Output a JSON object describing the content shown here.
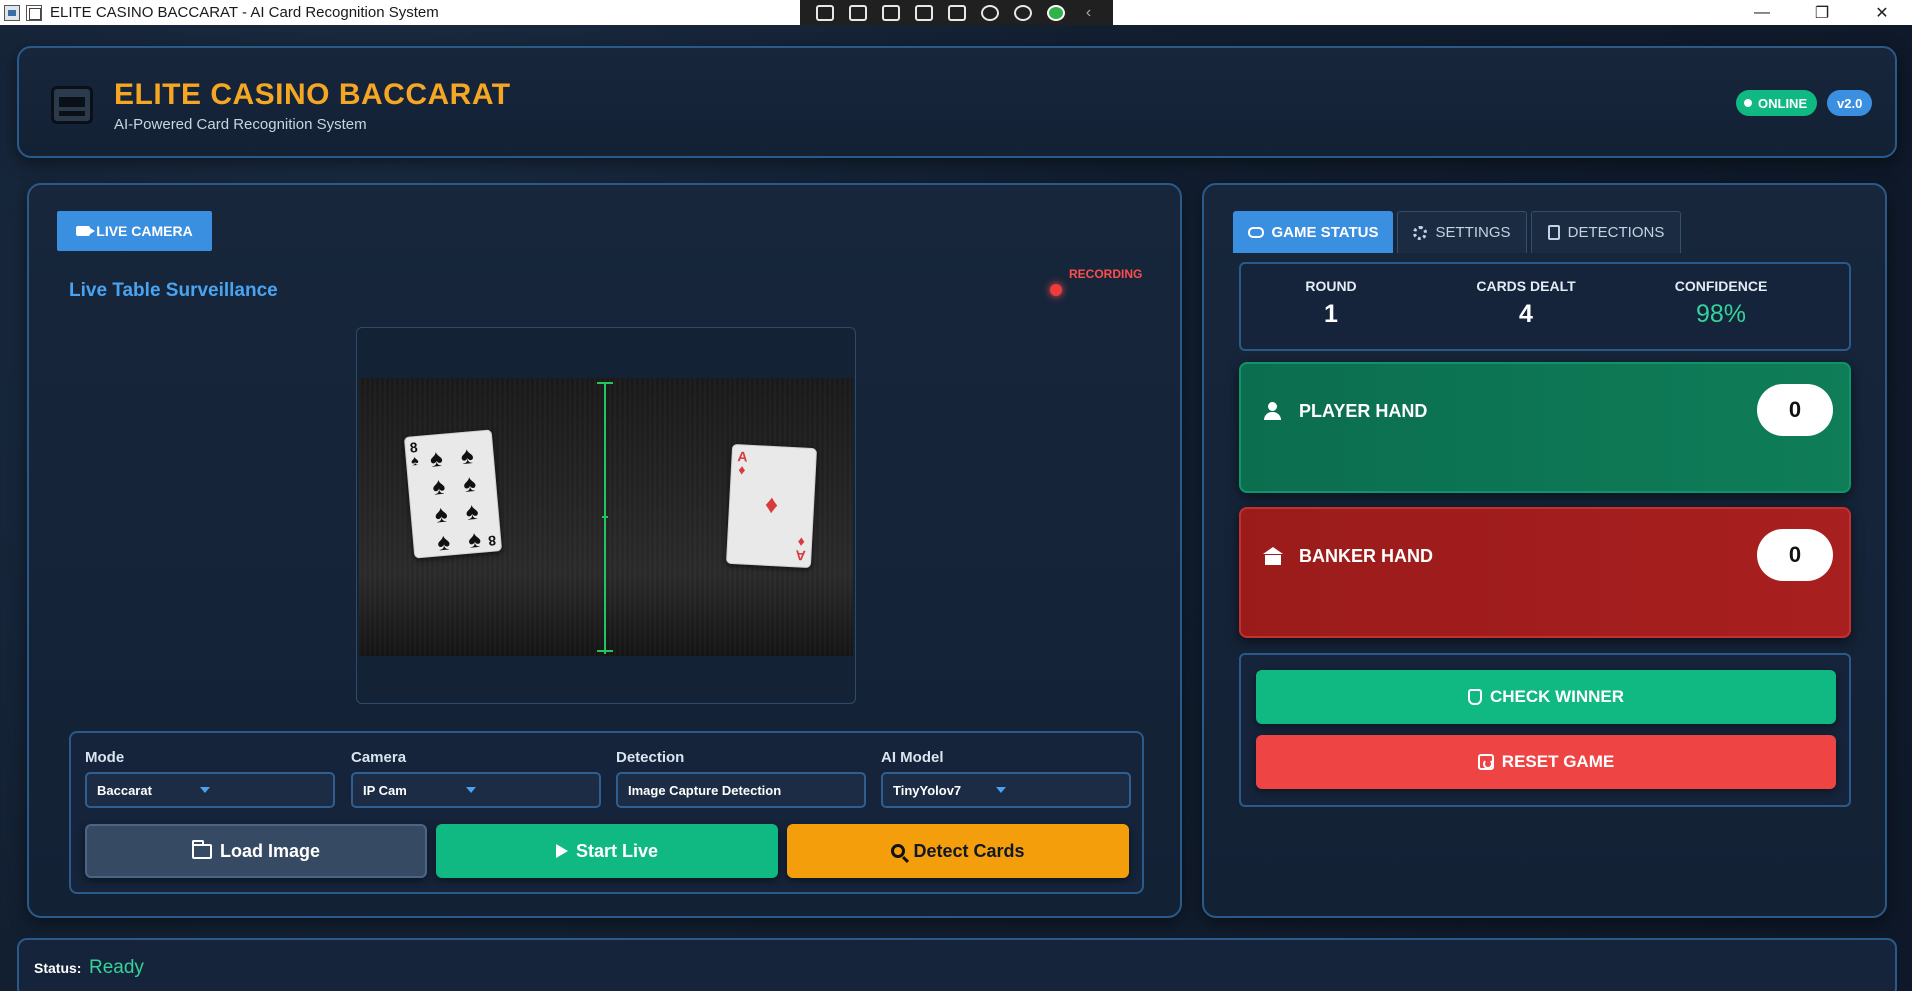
{
  "window": {
    "title": "ELITE CASINO BACCARAT - AI Card Recognition System",
    "minimize": "—",
    "restore": "❐",
    "close": "✕"
  },
  "header": {
    "title": "ELITE CASINO BACCARAT",
    "subtitle": "AI-Powered Card Recognition System",
    "status_badge": "ONLINE",
    "version_badge": "v2.0"
  },
  "camera": {
    "tab_label": "LIVE CAMERA",
    "section_title": "Live Table Surveillance",
    "recording_label": "RECORDING",
    "cards": [
      {
        "rank": "8",
        "suit": "♠",
        "color": "#111111"
      },
      {
        "rank": "A",
        "suit": "♦",
        "color": "#d63c3c"
      }
    ]
  },
  "controls": {
    "mode": {
      "label": "Mode",
      "value": "Baccarat"
    },
    "camera": {
      "label": "Camera",
      "value": "IP Cam"
    },
    "detection": {
      "label": "Detection",
      "value": "Image Capture Detection"
    },
    "ai_model": {
      "label": "AI Model",
      "value": "TinyYolov7"
    },
    "load_button": "Load Image",
    "live_button": "Start Live",
    "detect_button": "Detect Cards"
  },
  "game": {
    "tabs": [
      "GAME STATUS",
      "SETTINGS",
      "DETECTIONS"
    ],
    "active_tab": "GAME STATUS",
    "stats": {
      "round_label": "ROUND",
      "round_value": "1",
      "cards_label": "CARDS DEALT",
      "cards_value": "4",
      "confidence_label": "CONFIDENCE",
      "confidence_value": "98%"
    },
    "player": {
      "label": "PLAYER HAND",
      "score": "0"
    },
    "banker": {
      "label": "BANKER HAND",
      "score": "0"
    },
    "check_button": "CHECK WINNER",
    "reset_button": "RESET GAME"
  },
  "status": {
    "label": "Status:",
    "value": "Ready"
  },
  "colors": {
    "accent": "#3b8fe0",
    "gold": "#f5a623",
    "success": "#10b981",
    "danger": "#ef4444"
  }
}
